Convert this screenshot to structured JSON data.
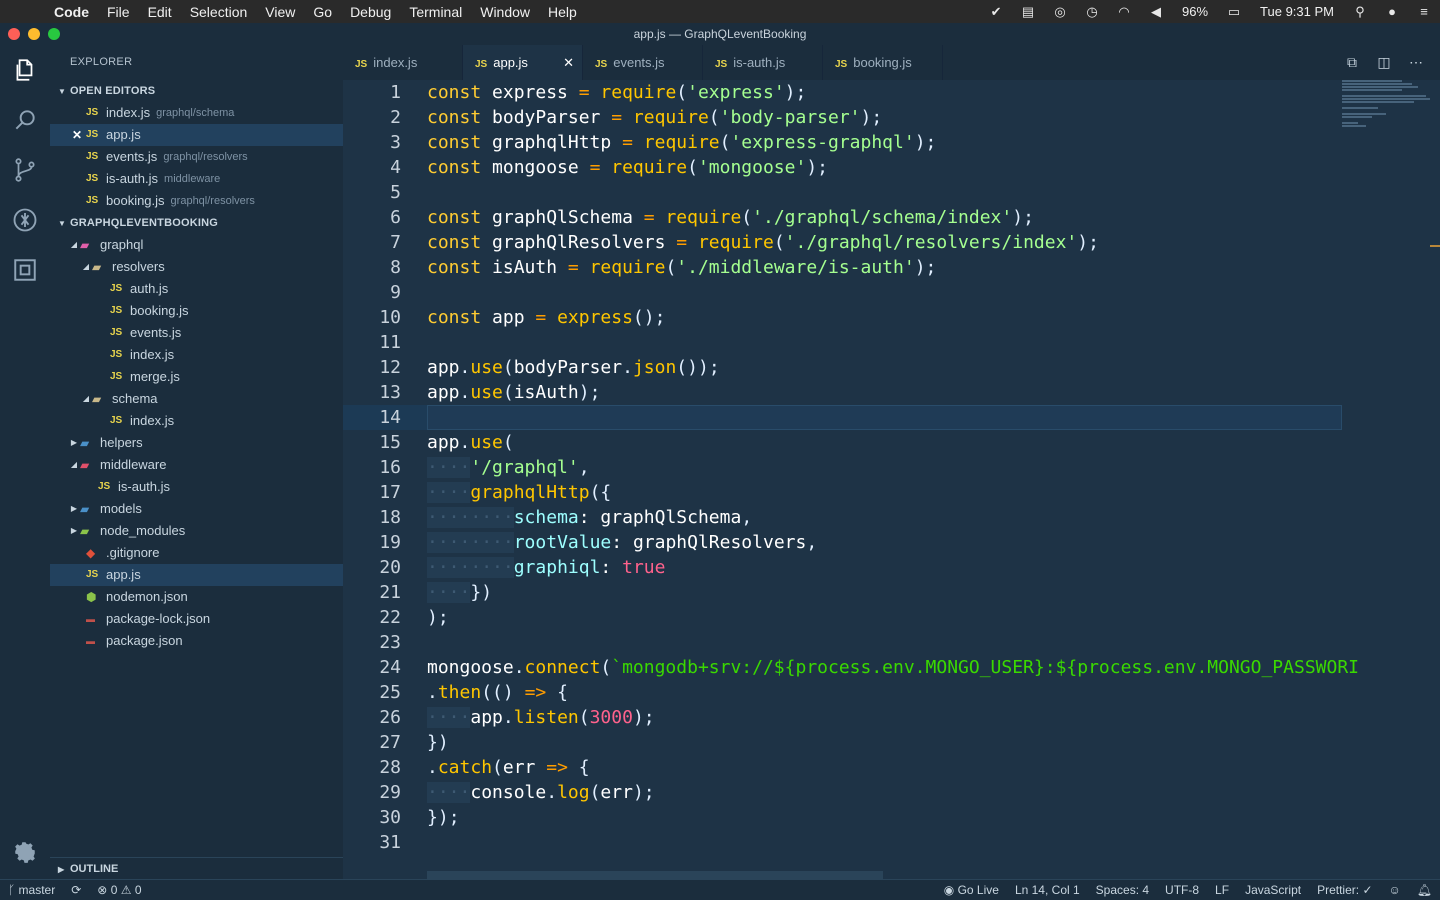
{
  "menubar": {
    "app_name": "Code",
    "items": [
      "File",
      "Edit",
      "Selection",
      "View",
      "Go",
      "Debug",
      "Terminal",
      "Window",
      "Help"
    ],
    "battery": "96%",
    "clock": "Tue 9:31 PM"
  },
  "window": {
    "title": "app.js — GraphQLeventBooking"
  },
  "sidebar": {
    "title": "EXPLORER",
    "open_editors_label": "OPEN EDITORS",
    "open_editors": [
      {
        "name": "index.js",
        "path": "graphql/schema"
      },
      {
        "name": "app.js",
        "path": ""
      },
      {
        "name": "events.js",
        "path": "graphql/resolvers"
      },
      {
        "name": "is-auth.js",
        "path": "middleware"
      },
      {
        "name": "booking.js",
        "path": "graphql/resolvers"
      }
    ],
    "project_label": "GRAPHQLEVENTBOOKING",
    "tree": {
      "graphql": "graphql",
      "resolvers": "resolvers",
      "resolver_files": [
        "auth.js",
        "booking.js",
        "events.js",
        "index.js",
        "merge.js"
      ],
      "schema": "schema",
      "schema_files": [
        "index.js"
      ],
      "helpers": "helpers",
      "middleware": "middleware",
      "middleware_files": [
        "is-auth.js"
      ],
      "models": "models",
      "node_modules": "node_modules",
      "root_files": [
        ".gitignore",
        "app.js",
        "nodemon.json",
        "package-lock.json",
        "package.json"
      ]
    },
    "outline_label": "OUTLINE"
  },
  "tabs": [
    "index.js",
    "app.js",
    "events.js",
    "is-auth.js",
    "booking.js"
  ],
  "js_badge": "JS",
  "statusbar": {
    "branch": "master",
    "errors": "0",
    "warnings": "0",
    "go_live": "Go Live",
    "position": "Ln 14, Col 1",
    "spaces": "Spaces: 4",
    "encoding": "UTF-8",
    "eol": "LF",
    "language": "JavaScript",
    "prettier": "Prettier: ✓"
  },
  "code_lines": [
    "const express = require('express');",
    "const bodyParser = require('body-parser');",
    "const graphqlHttp = require('express-graphql');",
    "const mongoose = require('mongoose');",
    "",
    "const graphQlSchema = require('./graphql/schema/index');",
    "const graphQlResolvers = require('./graphql/resolvers/index');",
    "const isAuth = require('./middleware/is-auth');",
    "",
    "const app = express();",
    "",
    "app.use(bodyParser.json());",
    "app.use(isAuth);",
    "",
    "app.use(",
    "    '/graphql',",
    "    graphqlHttp({",
    "        schema: graphQlSchema,",
    "        rootValue: graphQlResolvers,",
    "        graphiql: true",
    "    })",
    ");",
    "",
    "mongoose.connect(`mongodb+srv://${process.env.MONGO_USER}:${process.env.MONGO_PASSWORI",
    ".then(() => {",
    "    app.listen(3000);",
    "})",
    ".catch(err => {",
    "    console.log(err);",
    "});",
    ""
  ],
  "current_line": 14
}
